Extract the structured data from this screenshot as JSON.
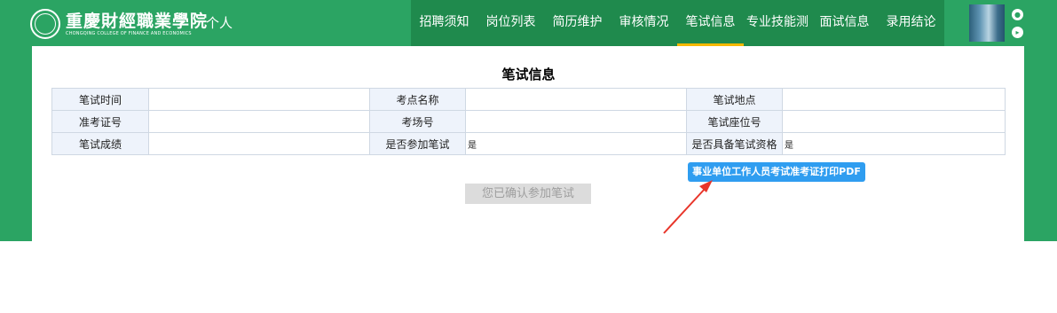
{
  "header": {
    "logo_cn": "重慶財經職業學院",
    "logo_en": "CHONGQING COLLEGE OF FINANCE AND ECONOMICS",
    "portal_label": "个人",
    "nav": [
      {
        "label": "招聘须知",
        "active": false
      },
      {
        "label": "岗位列表",
        "active": false
      },
      {
        "label": "简历维护",
        "active": false
      },
      {
        "label": "审核情况",
        "active": false
      },
      {
        "label": "笔试信息",
        "active": true
      },
      {
        "label": "专业技能测试",
        "active": false
      },
      {
        "label": "面试信息",
        "active": false
      },
      {
        "label": "录用结论",
        "active": false
      }
    ]
  },
  "main": {
    "title": "笔试信息",
    "rows": [
      [
        {
          "label": "笔试时间",
          "value": ""
        },
        {
          "label": "考点名称",
          "value": ""
        },
        {
          "label": "笔试地点",
          "value": ""
        }
      ],
      [
        {
          "label": "准考证号",
          "value": ""
        },
        {
          "label": "考场号",
          "value": ""
        },
        {
          "label": "笔试座位号",
          "value": ""
        }
      ],
      [
        {
          "label": "笔试成绩",
          "value": ""
        },
        {
          "label": "是否参加笔试",
          "value": "是"
        },
        {
          "label": "是否具备笔试资格",
          "value": "是"
        }
      ]
    ],
    "pdf_button": "事业单位工作人员考试准考证打印PDF",
    "confirm_button": "您已确认参加笔试"
  },
  "colors": {
    "brand_green": "#2ba463",
    "nav_dark_green": "#1f8a4d",
    "active_underline": "#f5b800",
    "pdf_button_blue": "#2f9df0",
    "arrow_red": "#e8352a"
  }
}
